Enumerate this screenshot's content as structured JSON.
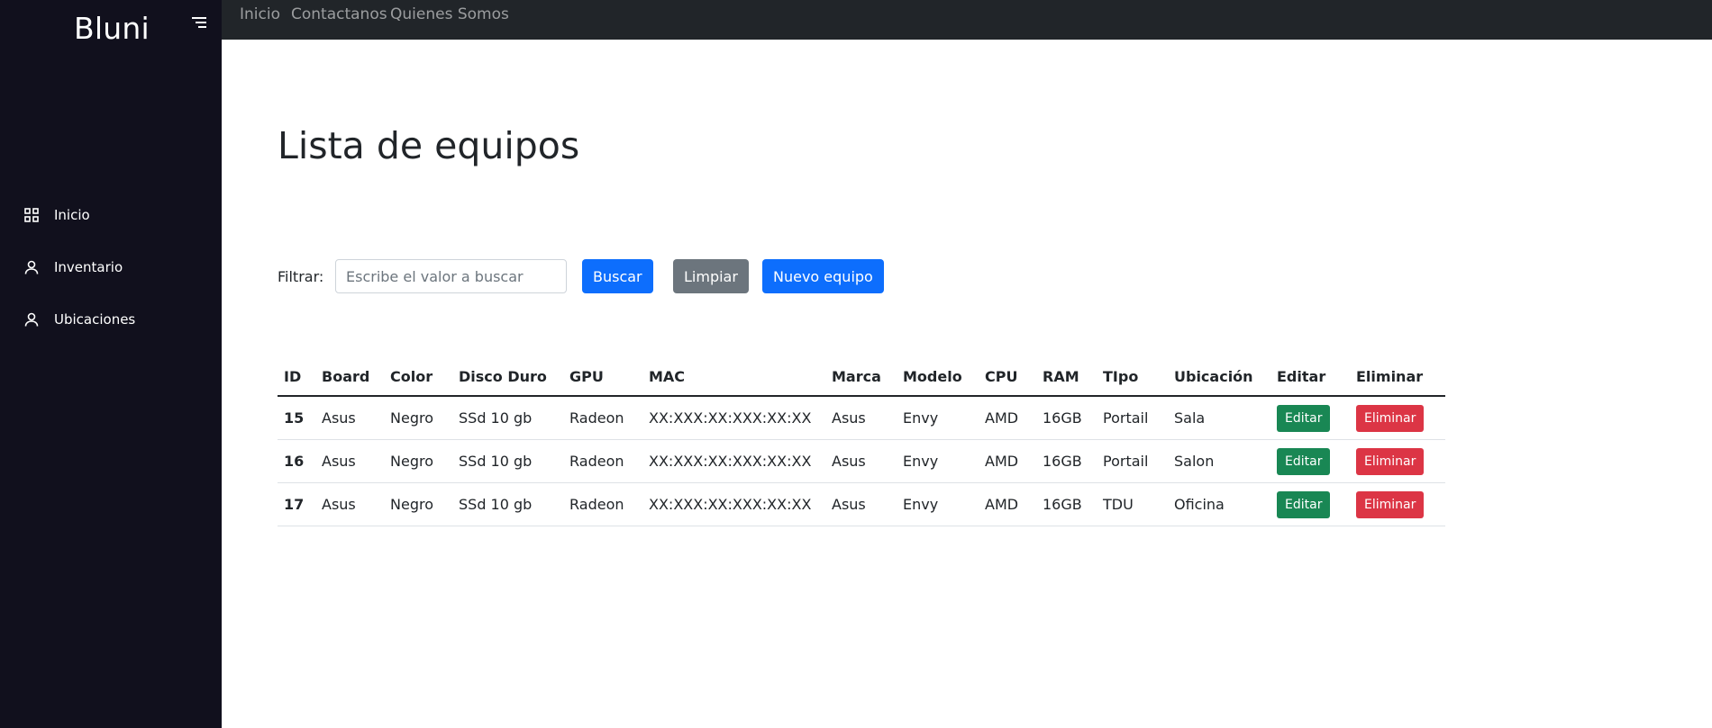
{
  "sidebar": {
    "brand": "Bluni",
    "items": [
      {
        "label": "Inicio",
        "icon": "grid-icon"
      },
      {
        "label": "Inventario",
        "icon": "user-icon"
      },
      {
        "label": "Ubicaciones",
        "icon": "user-icon"
      }
    ]
  },
  "topnav": {
    "links": [
      "Inicio",
      "Contactanos",
      "Quienes Somos"
    ]
  },
  "main": {
    "title": "Lista de equipos",
    "filter": {
      "label": "Filtrar:",
      "placeholder": "Escribe el valor a buscar",
      "value": "",
      "search_label": "Buscar",
      "clear_label": "Limpiar",
      "new_label": "Nuevo equipo"
    },
    "table": {
      "columns": [
        "ID",
        "Board",
        "Color",
        "Disco Duro",
        "GPU",
        "MAC",
        "Marca",
        "Modelo",
        "CPU",
        "RAM",
        "TIpo",
        "Ubicación",
        "Editar",
        "Eliminar"
      ],
      "rows": [
        {
          "id": "15",
          "board": "Asus",
          "color": "Negro",
          "disco": "SSd 10 gb",
          "gpu": "Radeon",
          "mac": "XX:XXX:XX:XXX:XX:XX",
          "marca": "Asus",
          "modelo": "Envy",
          "cpu": "AMD",
          "ram": "16GB",
          "tipo": "Portail",
          "ubicacion": "Sala",
          "edit_label": "Editar",
          "delete_label": "Eliminar"
        },
        {
          "id": "16",
          "board": "Asus",
          "color": "Negro",
          "disco": "SSd 10 gb",
          "gpu": "Radeon",
          "mac": "XX:XXX:XX:XXX:XX:XX",
          "marca": "Asus",
          "modelo": "Envy",
          "cpu": "AMD",
          "ram": "16GB",
          "tipo": "Portail",
          "ubicacion": "Salon",
          "edit_label": "Editar",
          "delete_label": "Eliminar"
        },
        {
          "id": "17",
          "board": "Asus",
          "color": "Negro",
          "disco": "SSd 10 gb",
          "gpu": "Radeon",
          "mac": "XX:XXX:XX:XXX:XX:XX",
          "marca": "Asus",
          "modelo": "Envy",
          "cpu": "AMD",
          "ram": "16GB",
          "tipo": "TDU",
          "ubicacion": "Oficina",
          "edit_label": "Editar",
          "delete_label": "Eliminar"
        }
      ]
    }
  },
  "colors": {
    "sidebar_bg": "#11101d",
    "topbar_bg": "#212529",
    "primary": "#0d6efd",
    "secondary": "#6c757d",
    "success": "#198754",
    "danger": "#dc3545"
  }
}
